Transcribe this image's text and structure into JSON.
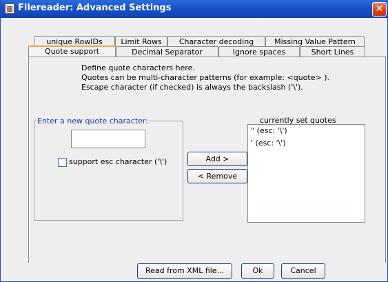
{
  "window": {
    "title": "Filereader: Advanced Settings",
    "close_glyph": "✕"
  },
  "tabs_row1": [
    {
      "label": "unique RowIDs"
    },
    {
      "label": "Limit Rows"
    },
    {
      "label": "Character decoding"
    },
    {
      "label": "Missing Value Pattern"
    }
  ],
  "tabs_row2": [
    {
      "label": "Quote support",
      "selected": true
    },
    {
      "label": "Decimal Separator"
    },
    {
      "label": "Ignore spaces"
    },
    {
      "label": "Short Lines"
    }
  ],
  "description": [
    "Define quote characters here.",
    "Quotes can be multi-character patterns (for example: <quote> ).",
    "Escape character (if checked) is always the backslash ('\\')."
  ],
  "new_quote": {
    "group_title": "Enter a new quote character:",
    "input_value": "",
    "esc_label": "support esc character ('\\')",
    "esc_checked": false
  },
  "actions": {
    "add_label": "Add >",
    "remove_label": "< Remove"
  },
  "quotes": {
    "title": "currently set quotes",
    "items": [
      "\"  (esc: '\\')",
      "'  (esc: '\\')"
    ]
  },
  "footer": {
    "read_xml_label": "Read from XML file...",
    "ok_label": "Ok",
    "cancel_label": "Cancel"
  },
  "colors": {
    "titlebar": "#1a55c9",
    "selected_tab_accent": "#f0a84a",
    "group_title": "#1a3aa8"
  }
}
